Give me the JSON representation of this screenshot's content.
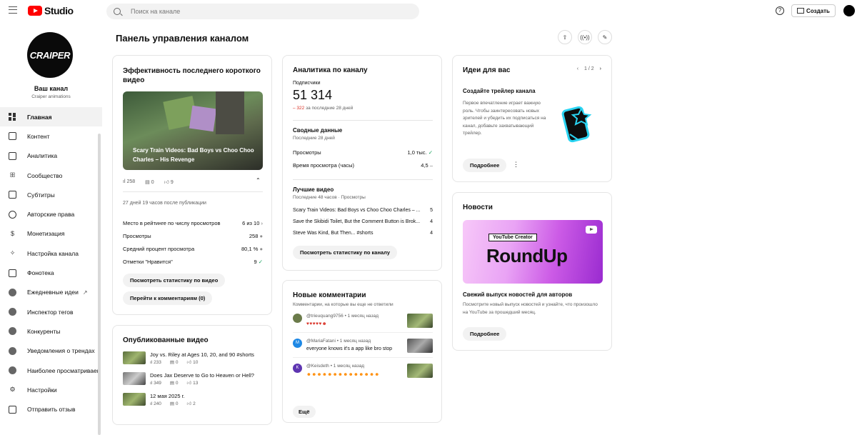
{
  "header": {
    "logo_text": "Studio",
    "search_placeholder": "Поиск на канале",
    "help_label": "?",
    "create_label": "Создать"
  },
  "channel": {
    "avatar_text": "CRAIPER",
    "name": "Ваш канал",
    "handle": "Craiper animations"
  },
  "nav": [
    {
      "label": "Главная",
      "icon": "dashboard-icon"
    },
    {
      "label": "Контент",
      "icon": "content-icon"
    },
    {
      "label": "Аналитика",
      "icon": "analytics-icon"
    },
    {
      "label": "Сообщество",
      "icon": "community-icon"
    },
    {
      "label": "Субтитры",
      "icon": "subtitles-icon"
    },
    {
      "label": "Авторские права",
      "icon": "copyright-icon"
    },
    {
      "label": "Монетизация",
      "icon": "monetization-icon"
    },
    {
      "label": "Настройка канала",
      "icon": "customization-icon"
    },
    {
      "label": "Фонотека",
      "icon": "audio-library-icon"
    },
    {
      "label": "Ежедневные идеи",
      "icon": "extension-icon"
    },
    {
      "label": "Инспектор тегов",
      "icon": "extension-icon"
    },
    {
      "label": "Конкуренты",
      "icon": "extension-icon"
    },
    {
      "label": "Уведомления о трендах",
      "icon": "extension-icon"
    },
    {
      "label": "Наиболее просматриваемые",
      "icon": "extension-icon"
    },
    {
      "label": "Настройки",
      "icon": "settings-icon"
    },
    {
      "label": "Отправить отзыв",
      "icon": "feedback-icon"
    }
  ],
  "page": {
    "title": "Панель управления каналом"
  },
  "latest_short": {
    "title": "Эффективность последнего короткого видео",
    "video_title": "Scary Train Videos: Bad Boys vs Choo Choo Charles – His Revenge",
    "views": "258",
    "comments": "0",
    "likes": "9",
    "age": "27 дней 19 часов после публикации",
    "rows": [
      {
        "label": "Место в рейтинге по числу просмотров",
        "value": "6 из 10",
        "mark": "›"
      },
      {
        "label": "Просмотры",
        "value": "258",
        "mark": "●"
      },
      {
        "label": "Средний процент просмотра",
        "value": "80,1 %",
        "mark": "●"
      },
      {
        "label": "Отметки \"Нравится\"",
        "value": "9",
        "mark": "✓"
      }
    ],
    "btn_stats": "Посмотреть статистику по видео",
    "btn_comments": "Перейти к комментариям (0)"
  },
  "published": {
    "title": "Опубликованные видео",
    "videos": [
      {
        "title": "Joy vs. Riley at Ages 10, 20, and 90 #shorts",
        "views": "233",
        "comments": "0",
        "likes": "10"
      },
      {
        "title": "Does Jax Deserve to Go to Heaven or Hell?",
        "views": "349",
        "comments": "0",
        "likes": "13"
      },
      {
        "title": "12 мая 2025 г.",
        "views": "240",
        "comments": "0",
        "likes": "2"
      }
    ]
  },
  "analytics": {
    "title": "Аналитика по каналу",
    "subs_label": "Подписчики",
    "subs_value": "51 314",
    "subs_delta": "– 322",
    "subs_delta_period": "за последние 28 дней",
    "summary_title": "Сводные данные",
    "summary_period": "Последние 28 дней",
    "summary_rows": [
      {
        "label": "Просмотры",
        "value": "1,0 тыс.",
        "mark": "✓"
      },
      {
        "label": "Время просмотра (часы)",
        "value": "4,5",
        "mark": "–"
      }
    ],
    "top_title": "Лучшие видео",
    "top_period": "Последние 48 часов · Просмотры",
    "top_rows": [
      {
        "label": "Scary Train Videos: Bad Boys vs Choo Choo Charles – ...",
        "value": "5"
      },
      {
        "label": "Save the Skibidi Toilet, But the Comment Button is Brok...",
        "value": "4"
      },
      {
        "label": "Steve Was Kind, But Then... #shorts",
        "value": "4"
      }
    ],
    "btn": "Посмотреть статистику по каналу"
  },
  "comments": {
    "title": "Новые комментарии",
    "subtitle": "Комментарии, на которые вы еще не ответили",
    "items": [
      {
        "author": "@trieuquang9756 • 1 месяц назад",
        "text": "♥♥♥♥♥☻",
        "initial": "",
        "color": "#6b7b4a"
      },
      {
        "author": "@MariaFatani • 1 месяц назад",
        "text": "everyone knows it's a app like bro stop",
        "initial": "M",
        "color": "#1e88e5"
      },
      {
        "author": "@Keisdeth • 1 месяц назад",
        "text": "☻☻☻☻☻☻☻☻☻☻☻☻☻☻",
        "initial": "K",
        "color": "#5e35b1"
      }
    ],
    "more_btn": "Ещё"
  },
  "ideas": {
    "title": "Идеи для вас",
    "pager": "1 / 2",
    "card_title": "Создайте трейлер канала",
    "card_text": "Первое впечатление играет важную роль. Чтобы заинтересовать новых зрителей и убедить их подписаться на канал, добавьте захватывающий трейлер.",
    "btn": "Подробнее"
  },
  "news": {
    "title": "Новости",
    "banner_tag": "YouTube Creator",
    "banner_big": "RoundUp",
    "headline": "Свежий выпуск новостей для авторов",
    "text": "Посмотрите новый выпуск новостей и узнайте, что произошло на YouTube за прошедший месяц.",
    "btn": "Подробнее"
  },
  "colors": {
    "brand_red": "#ff0000",
    "negative": "#d93025",
    "positive": "#0f9d58"
  }
}
